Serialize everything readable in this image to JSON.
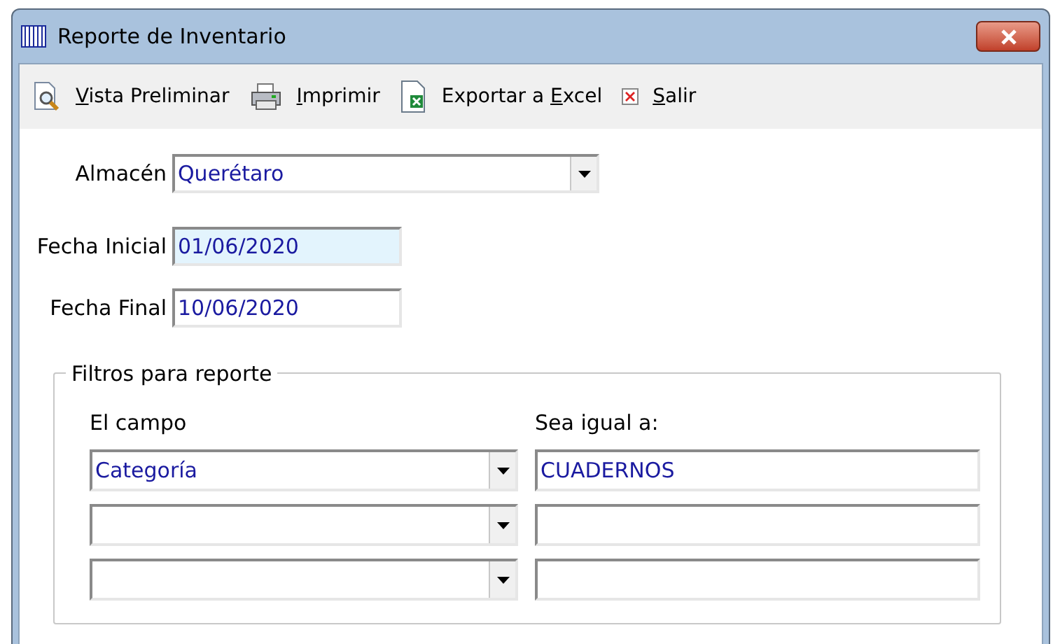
{
  "window": {
    "title": "Reporte de Inventario"
  },
  "toolbar": [
    {
      "kind": "preview",
      "key": "V",
      "post": "ista Preliminar"
    },
    {
      "kind": "print",
      "key": "I",
      "post": "mprimir"
    },
    {
      "kind": "excel",
      "pre": "Exportar a ",
      "key": "E",
      "post": "xcel"
    },
    {
      "kind": "exit",
      "key": "S",
      "post": "alir"
    }
  ],
  "almacen": {
    "label": "Almacén",
    "value": "Querétaro"
  },
  "fecha_inicial": {
    "label": "Fecha Inicial",
    "value": "01/06/2020",
    "focused": true
  },
  "fecha_final": {
    "label": "Fecha Final",
    "value": "10/06/2020",
    "focused": false
  },
  "filters": {
    "title": "Filtros para reporte",
    "field_header": "El campo",
    "value_header": "Sea igual a:",
    "rows": [
      {
        "field": "Categoría",
        "value": "CUADERNOS"
      },
      {},
      {}
    ]
  }
}
